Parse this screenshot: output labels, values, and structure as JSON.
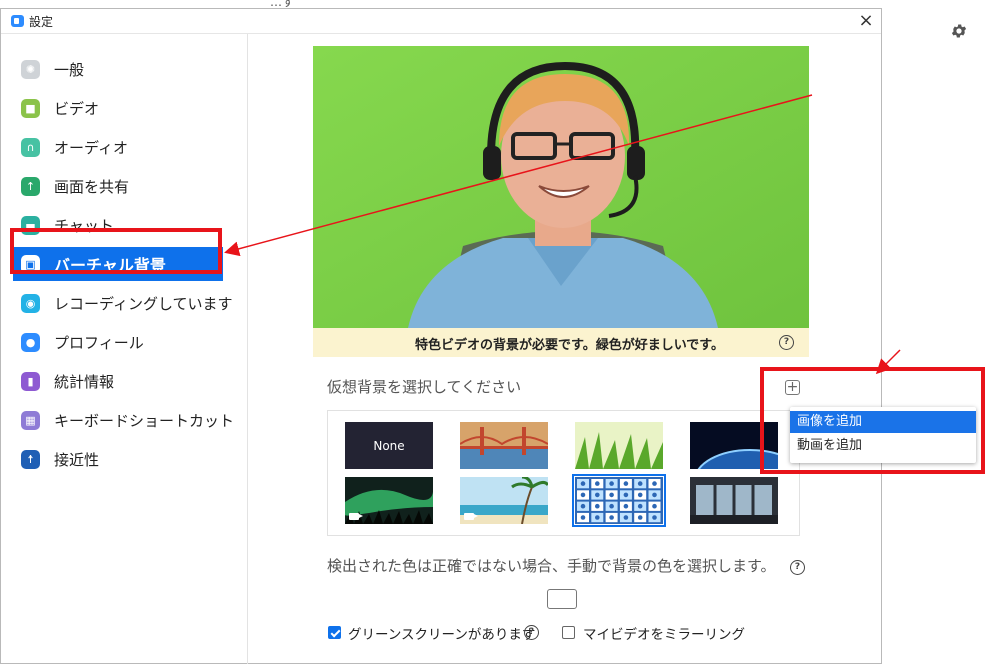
{
  "background": {
    "top_strip_text": "…す",
    "gear_icon": "gear-icon"
  },
  "window": {
    "title": "設定",
    "close_label": "×"
  },
  "sidebar": {
    "items": [
      {
        "label": "一般",
        "icon": "gear-icon",
        "color": "#cfd3d7"
      },
      {
        "label": "ビデオ",
        "icon": "video-camera-icon",
        "color": "#8bc34a"
      },
      {
        "label": "オーディオ",
        "icon": "headphones-icon",
        "color": "#47c2a3"
      },
      {
        "label": "画面を共有",
        "icon": "share-screen-icon",
        "color": "#2aa86b"
      },
      {
        "label": "チャット",
        "icon": "chat-bubble-icon",
        "color": "#2bb0a0"
      },
      {
        "label": "バーチャル背景",
        "icon": "virtual-background-icon",
        "color": "#0e71eb",
        "active": true
      },
      {
        "label": "レコーディングしています",
        "icon": "record-icon",
        "color": "#23b2e6"
      },
      {
        "label": "プロフィール",
        "icon": "profile-icon",
        "color": "#2d8cff"
      },
      {
        "label": "統計情報",
        "icon": "statistics-icon",
        "color": "#8e5ad2"
      },
      {
        "label": "キーボードショートカット",
        "icon": "keyboard-icon",
        "color": "#8e7bd6"
      },
      {
        "label": "接近性",
        "icon": "accessibility-icon",
        "color": "#1f5fb5"
      }
    ]
  },
  "main": {
    "notice": "特色ビデオの背景が必要です。緑色が好ましいです。",
    "help_glyph": "?",
    "choose_label": "仮想背景を選択してください",
    "add_glyph": "+",
    "thumbnails": [
      {
        "label": "None",
        "kind": "none"
      },
      {
        "label": "",
        "kind": "golden-gate-bridge"
      },
      {
        "label": "",
        "kind": "grass"
      },
      {
        "label": "",
        "kind": "earth-from-space"
      },
      {
        "label": "",
        "kind": "aurora",
        "video": true
      },
      {
        "label": "",
        "kind": "beach",
        "video": true
      },
      {
        "label": "",
        "kind": "zoom-pattern",
        "selected": true
      },
      {
        "label": "",
        "kind": "office-windows"
      }
    ],
    "dropdown": {
      "items": [
        "画像を追加",
        "動画を追加"
      ]
    },
    "detect_label": "検出された色は正確ではない場合、手動で背景の色を選択します。",
    "green_screen_label": "グリーンスクリーンがあります",
    "green_screen_checked": true,
    "mirror_label": "マイビデオをミラーリング",
    "mirror_checked": false
  },
  "colors": {
    "accent": "#0e71eb",
    "annotation_red": "#e8141a",
    "preview_green": "#7ed14b",
    "notice_bg": "#fbf3cf"
  }
}
